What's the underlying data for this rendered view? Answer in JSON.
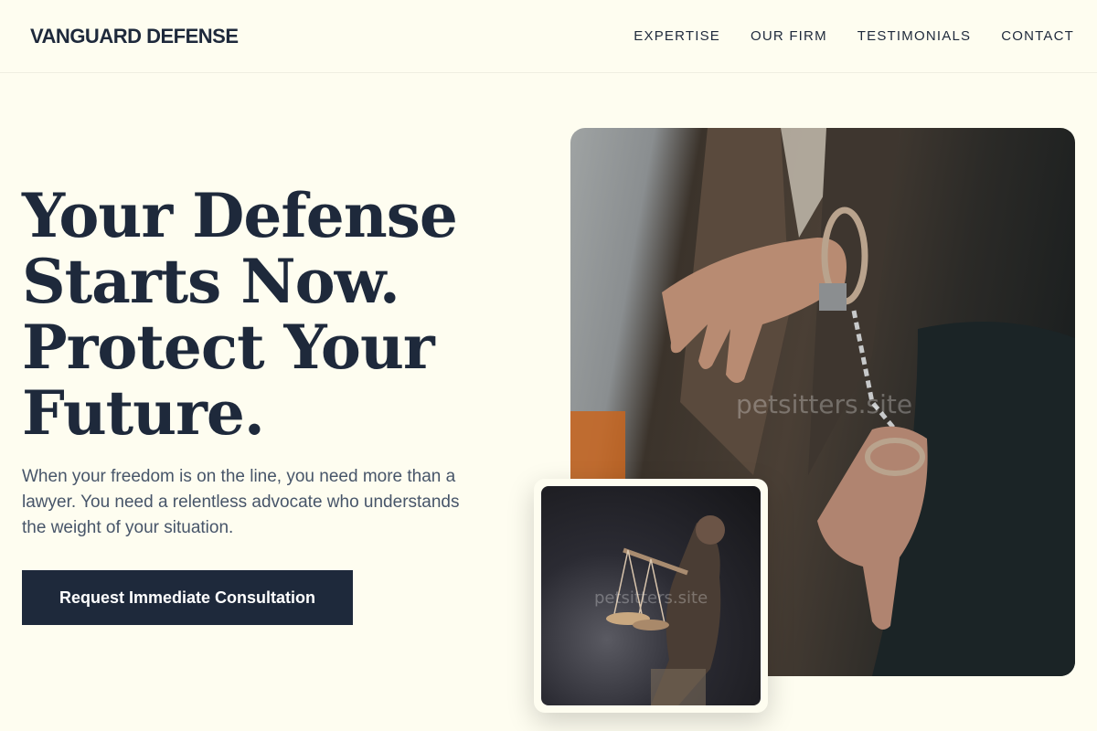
{
  "header": {
    "logo": "VANGUARD DEFENSE",
    "nav": [
      "EXPERTISE",
      "OUR FIRM",
      "TESTIMONIALS",
      "CONTACT"
    ]
  },
  "hero": {
    "title_lines": [
      "Your Defense",
      "Starts Now.",
      "Protect Your",
      "Future."
    ],
    "subtitle": "When your freedom is on the line, you need more than a lawyer. You need a relentless advocate who understands the weight of your situation.",
    "cta": "Request Immediate Consultation"
  },
  "images": {
    "main_watermark": "petsitters.site",
    "small_watermark": "petsitters.site"
  },
  "colors": {
    "background": "#fefdf0",
    "primary": "#1e293b",
    "muted": "#475569"
  }
}
